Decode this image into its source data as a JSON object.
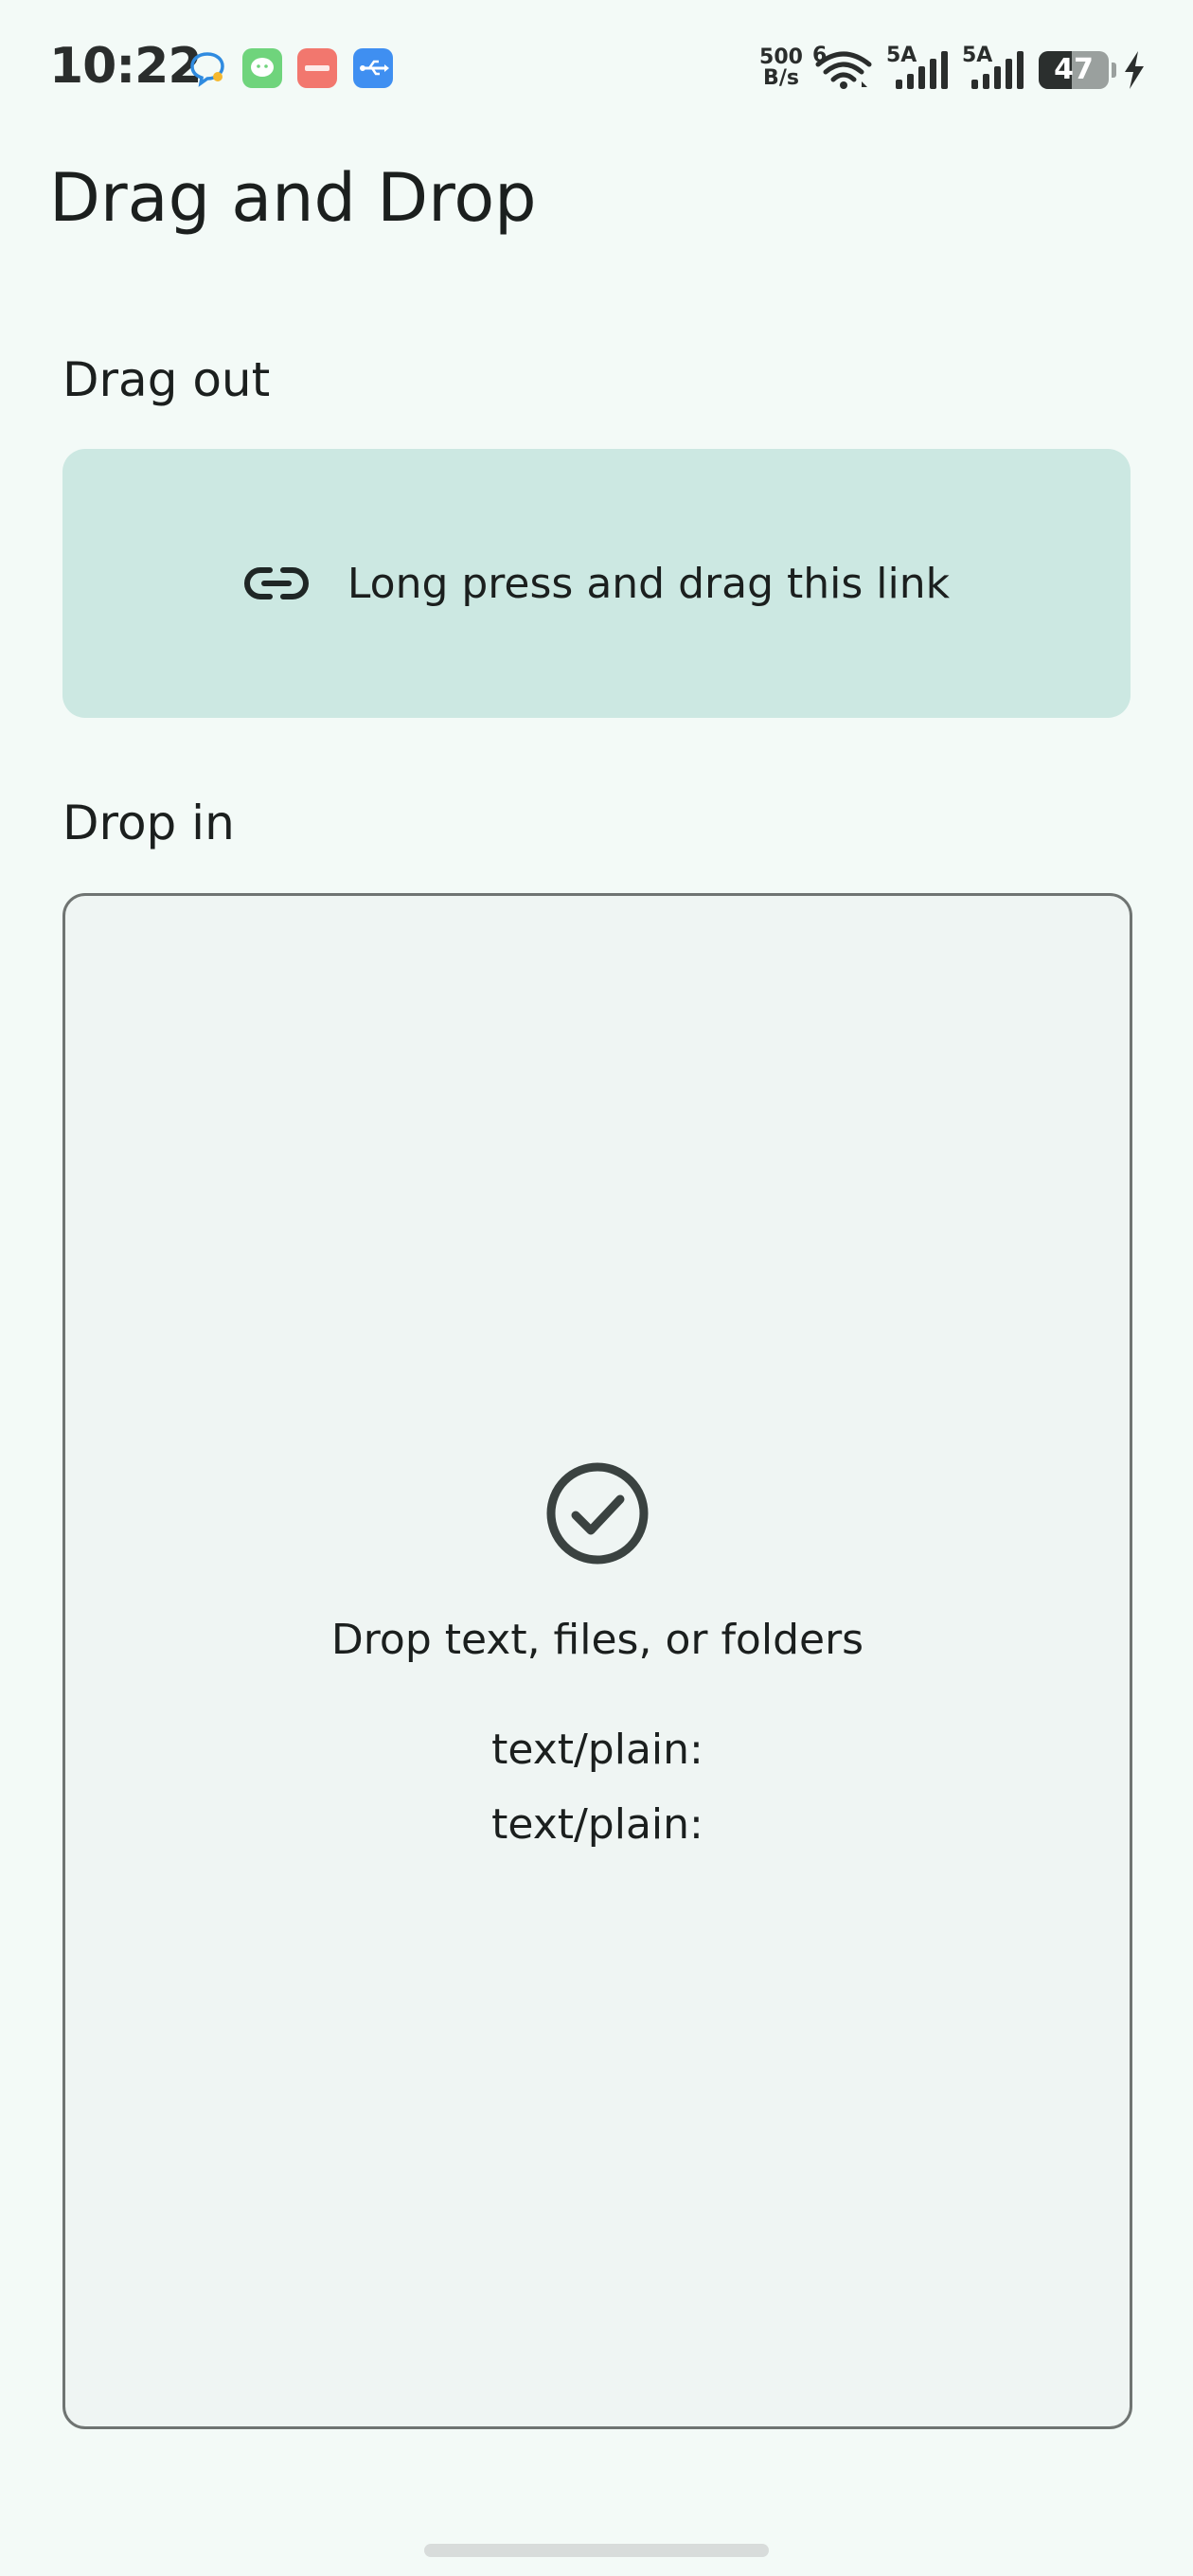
{
  "status_bar": {
    "time": "10:22",
    "net_speed_value": "500",
    "net_speed_unit": "B/s",
    "wifi_label": "6",
    "signal1_label": "5A",
    "signal2_label": "5A",
    "battery_percent": 47,
    "battery_text": "47"
  },
  "app": {
    "title": "Drag and Drop"
  },
  "drag_out": {
    "heading": "Drag out",
    "label": "Long press and drag this link"
  },
  "drop_in": {
    "heading": "Drop in",
    "label": "Drop text, files, or folders",
    "mime_lines": [
      "text/plain:",
      "text/plain:"
    ]
  },
  "colors": {
    "background": "#f3faf7",
    "drag_card": "#cce8e2",
    "drop_zone": "#eff5f3",
    "drop_border": "#6f7472",
    "icon": "#3a4240"
  }
}
